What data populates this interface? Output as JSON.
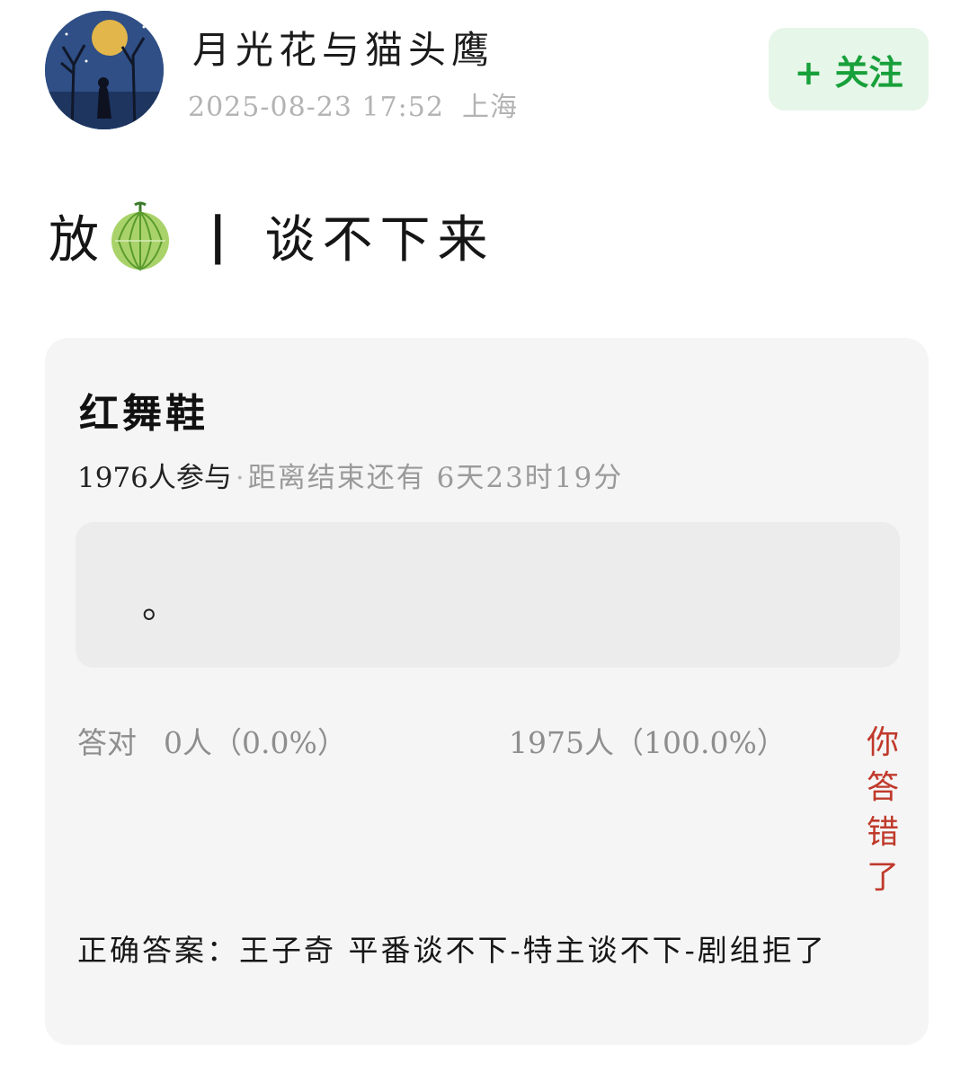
{
  "author": {
    "name": "月光花与猫头鹰",
    "datetime": "2025-08-23 17:52",
    "location": "上海",
    "follow_label": "+ 关注",
    "avatar_icon": "night-moon-figure-avatar"
  },
  "post": {
    "title_left": "放",
    "emoji_icon": "melon-icon",
    "separator": "|",
    "title_right": "谈不下来"
  },
  "quiz": {
    "title": "红舞鞋",
    "participants": "1976人参与",
    "dot": "·",
    "remaining": "距离结束还有 6天23时19分",
    "question": "。",
    "correct_label": "答对",
    "correct_count": "0人（0.0%）",
    "wrong_count": "1975人（100.0%）",
    "wrong_badge": "你答错了",
    "answer": "正确答案：王子奇 平番谈不下-特主谈不下-剧组拒了"
  },
  "colors": {
    "follow_bg": "#e6f6e9",
    "follow_text": "#18a03a",
    "wrong_text": "#c0392b",
    "card_bg": "#f5f5f5"
  }
}
